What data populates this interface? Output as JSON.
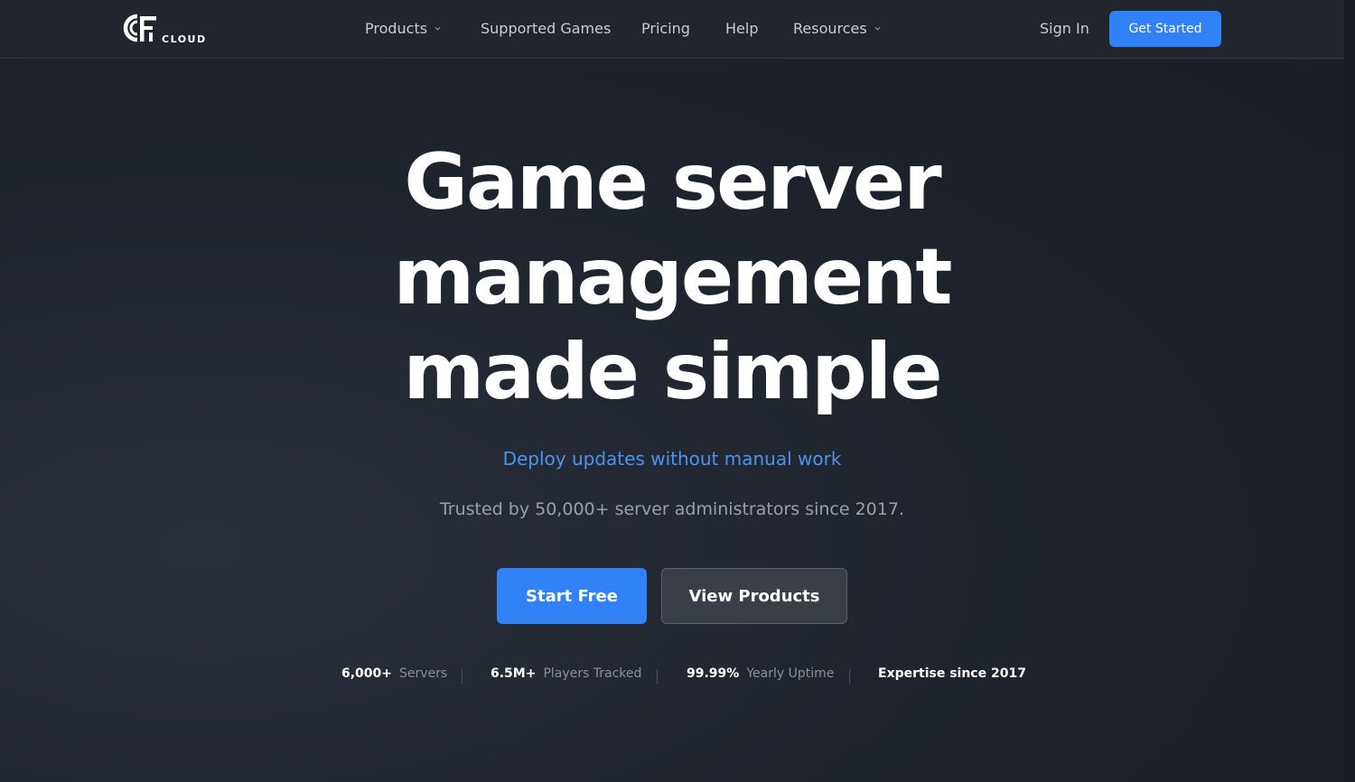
{
  "brand": {
    "logo_word": "CLOUD"
  },
  "nav": {
    "items": [
      {
        "label": "Products",
        "has_dropdown": true
      },
      {
        "label": "Supported Games",
        "has_dropdown": false
      },
      {
        "label": "Pricing",
        "has_dropdown": false
      },
      {
        "label": "Help",
        "has_dropdown": false
      },
      {
        "label": "Resources",
        "has_dropdown": true
      }
    ],
    "sign_in": "Sign In",
    "get_started": "Get Started"
  },
  "hero": {
    "title_lines": [
      "Game server",
      "management",
      "made simple"
    ],
    "subheading": "Deploy updates without manual work",
    "tagline": "Trusted by 50,000+ server administrators since 2017.",
    "primary_cta": "Start Free",
    "secondary_cta": "View Products"
  },
  "stats": [
    {
      "value": "6,000+",
      "label": "Servers"
    },
    {
      "value": "6.5M+",
      "label": "Players Tracked"
    },
    {
      "value": "99.99%",
      "label": "Yearly Uptime"
    },
    {
      "value": "Expertise since 2017",
      "label": ""
    }
  ],
  "colors": {
    "accent": "#3082f6",
    "subheading": "#4d92f0",
    "background": "#1f242d"
  }
}
